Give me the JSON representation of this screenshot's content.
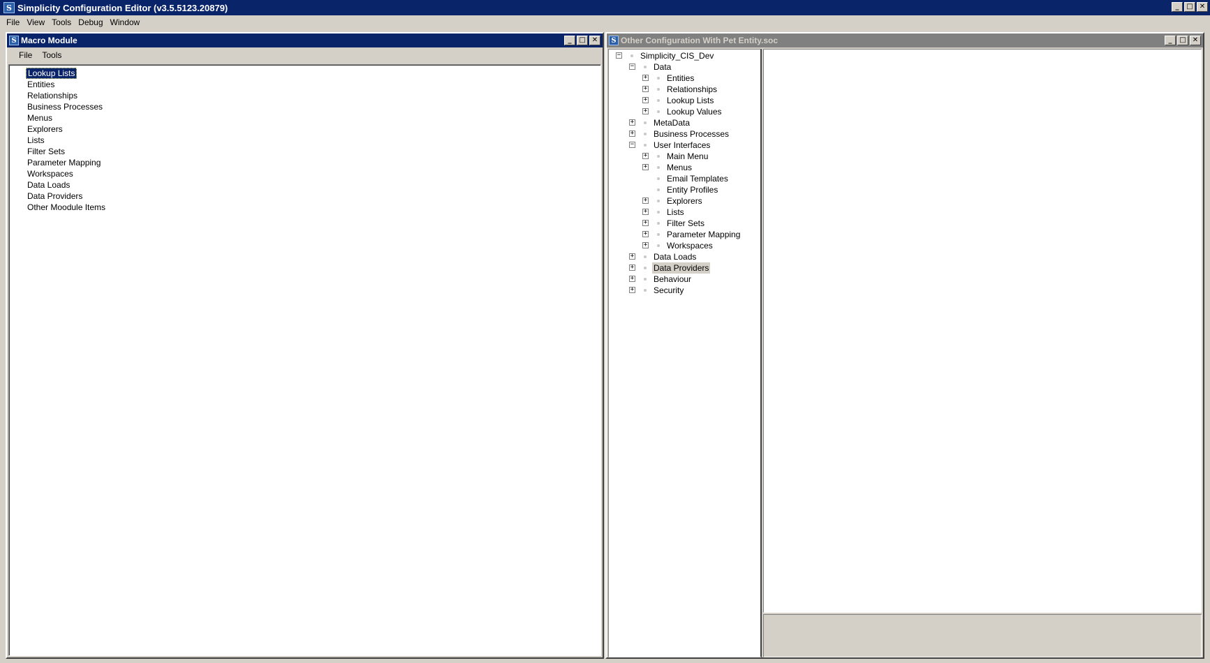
{
  "app": {
    "title": "Simplicity Configuration Editor (v3.5.5123.20879)",
    "icon": "S",
    "window_buttons": [
      "_",
      "□",
      "✕"
    ]
  },
  "menubar": [
    "File",
    "View",
    "Tools",
    "Debug",
    "Window"
  ],
  "macro_window": {
    "title": "Macro Module",
    "menu": [
      "File",
      "Tools"
    ],
    "items": [
      "Lookup Lists",
      "Entities",
      "Relationships",
      "Business Processes",
      "Menus",
      "Explorers",
      "Lists",
      "Filter Sets",
      "Parameter Mapping",
      "Workspaces",
      "Data Loads",
      "Data Providers",
      "Other Moodule Items"
    ],
    "selected_item": "Lookup Lists"
  },
  "config_window": {
    "title": "Other Configuration With Pet Entity.soc",
    "tree": [
      {
        "label": "Simplicity_CIS_Dev",
        "level": 0,
        "expander": "−"
      },
      {
        "label": "Data",
        "level": 1,
        "expander": "−"
      },
      {
        "label": "Entities",
        "level": 2,
        "expander": "+"
      },
      {
        "label": "Relationships",
        "level": 2,
        "expander": "+"
      },
      {
        "label": "Lookup Lists",
        "level": 2,
        "expander": "+"
      },
      {
        "label": "Lookup Values",
        "level": 2,
        "expander": "+"
      },
      {
        "label": "MetaData",
        "level": 1,
        "expander": "+"
      },
      {
        "label": "Business Processes",
        "level": 1,
        "expander": "+"
      },
      {
        "label": "User Interfaces",
        "level": 1,
        "expander": "−"
      },
      {
        "label": "Main Menu",
        "level": 2,
        "expander": "+"
      },
      {
        "label": "Menus",
        "level": 2,
        "expander": "+"
      },
      {
        "label": "Email Templates",
        "level": 2,
        "expander": ""
      },
      {
        "label": "Entity Profiles",
        "level": 2,
        "expander": ""
      },
      {
        "label": "Explorers",
        "level": 2,
        "expander": "+"
      },
      {
        "label": "Lists",
        "level": 2,
        "expander": "+"
      },
      {
        "label": "Filter Sets",
        "level": 2,
        "expander": "+"
      },
      {
        "label": "Parameter Mapping",
        "level": 2,
        "expander": "+"
      },
      {
        "label": "Workspaces",
        "level": 2,
        "expander": "+"
      },
      {
        "label": "Data Loads",
        "level": 1,
        "expander": "+"
      },
      {
        "label": "Data Providers",
        "level": 1,
        "expander": "+",
        "hover": true
      },
      {
        "label": "Behaviour",
        "level": 1,
        "expander": "+"
      },
      {
        "label": "Security",
        "level": 1,
        "expander": "+"
      }
    ]
  }
}
